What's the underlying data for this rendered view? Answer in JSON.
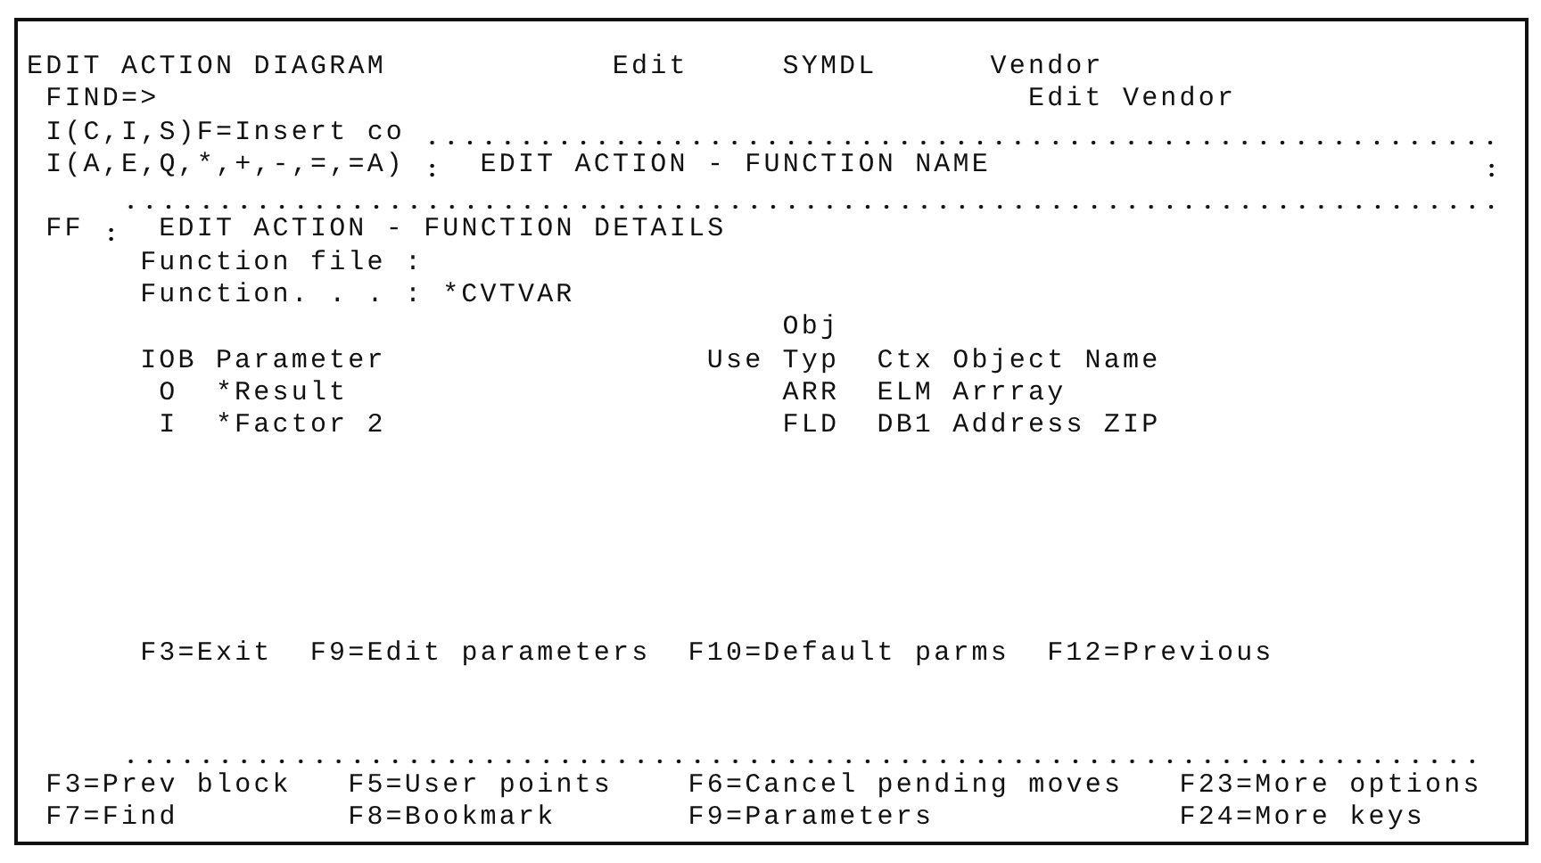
{
  "header": {
    "title": "EDIT ACTION DIAGRAM",
    "mode": "Edit",
    "model": "SYMDL",
    "entity": "Vendor"
  },
  "find": {
    "label": "FIND=>",
    "context": "Edit Vendor"
  },
  "insert_hint": "I(C,I,S)F=Insert co",
  "action_hint": "I(A,E,Q,*,+,-,=,=A)",
  "function_name_window": {
    "title": "EDIT ACTION - FUNCTION NAME"
  },
  "details_window": {
    "line_code": "FF",
    "title": "EDIT ACTION - FUNCTION DETAILS",
    "fields": [
      {
        "label": "Function file :"
      },
      {
        "label": "Function. . . :",
        "value": "*CVTVAR"
      }
    ],
    "table": {
      "columns": [
        {
          "kind": "iob",
          "label": "IOB"
        },
        {
          "kind": "parameter",
          "label": "Parameter"
        },
        {
          "kind": "use",
          "label": "Use"
        },
        {
          "kind": "typ",
          "label": "Typ",
          "label_above": "Obj"
        },
        {
          "kind": "ctx",
          "label": "Ctx"
        },
        {
          "kind": "name",
          "label": "Object Name"
        }
      ],
      "rows": [
        {
          "iob": "O",
          "parameter": "*Result",
          "typ": "ARR",
          "ctx": "ELM",
          "name": "Arrray"
        },
        {
          "iob": "I",
          "parameter": "*Factor 2",
          "typ": "FLD",
          "ctx": "DB1",
          "name": "Address ZIP"
        }
      ]
    },
    "function_keys": [
      "F3=Exit",
      "F9=Edit parameters",
      "F10=Default parms",
      "F12=Previous"
    ]
  },
  "command_keys": [
    [
      "F3=Prev block",
      "F5=User points",
      "F6=Cancel pending moves",
      "F23=More options"
    ],
    [
      "F7=Find",
      "F8=Bookmark",
      "F9=Parameters",
      "F24=More keys"
    ]
  ]
}
